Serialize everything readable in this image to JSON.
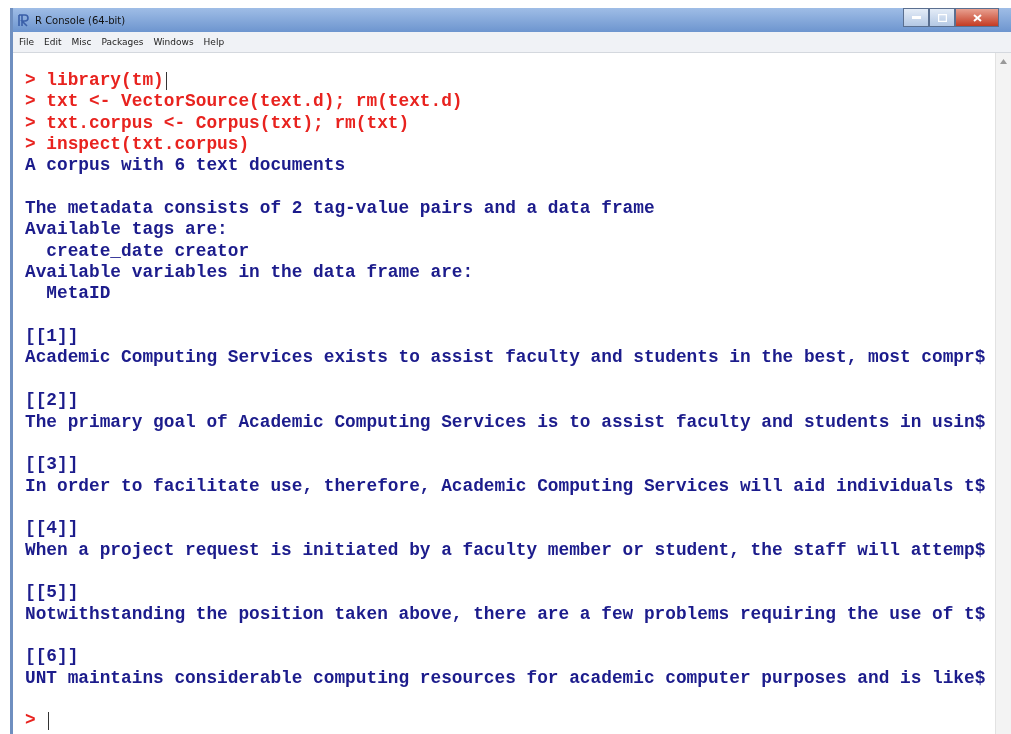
{
  "window": {
    "title": "R Console (64-bit)"
  },
  "menu": [
    "File",
    "Edit",
    "Misc",
    "Packages",
    "Windows",
    "Help"
  ],
  "console": [
    {
      "kind": "input",
      "text": "library(tm)",
      "cursor": true
    },
    {
      "kind": "input",
      "text": "txt <- VectorSource(text.d); rm(text.d)",
      "cursor": false
    },
    {
      "kind": "input",
      "text": "txt.corpus <- Corpus(txt); rm(txt)",
      "cursor": false
    },
    {
      "kind": "input",
      "text": "inspect(txt.corpus)",
      "cursor": false
    },
    {
      "kind": "output",
      "text": "A corpus with 6 text documents"
    },
    {
      "kind": "blank"
    },
    {
      "kind": "output",
      "text": "The metadata consists of 2 tag-value pairs and a data frame"
    },
    {
      "kind": "output",
      "text": "Available tags are:"
    },
    {
      "kind": "output",
      "text": "  create_date creator"
    },
    {
      "kind": "output",
      "text": "Available variables in the data frame are:"
    },
    {
      "kind": "output",
      "text": "  MetaID"
    },
    {
      "kind": "blank"
    },
    {
      "kind": "output",
      "text": "[[1]]"
    },
    {
      "kind": "output",
      "text": "Academic Computing Services exists to assist faculty and students in the best, most compr$"
    },
    {
      "kind": "blank"
    },
    {
      "kind": "output",
      "text": "[[2]]"
    },
    {
      "kind": "output",
      "text": "The primary goal of Academic Computing Services is to assist faculty and students in usin$"
    },
    {
      "kind": "blank"
    },
    {
      "kind": "output",
      "text": "[[3]]"
    },
    {
      "kind": "output",
      "text": "In order to facilitate use, therefore, Academic Computing Services will aid individuals t$"
    },
    {
      "kind": "blank"
    },
    {
      "kind": "output",
      "text": "[[4]]"
    },
    {
      "kind": "output",
      "text": "When a project request is initiated by a faculty member or student, the staff will attemp$"
    },
    {
      "kind": "blank"
    },
    {
      "kind": "output",
      "text": "[[5]]"
    },
    {
      "kind": "output",
      "text": "Notwithstanding the position taken above, there are a few problems requiring the use of t$"
    },
    {
      "kind": "blank"
    },
    {
      "kind": "output",
      "text": "[[6]]"
    },
    {
      "kind": "output",
      "text": "UNT maintains considerable computing resources for academic computer purposes and is like$"
    },
    {
      "kind": "blank"
    },
    {
      "kind": "input",
      "cursor": true
    }
  ],
  "prompt": ">"
}
